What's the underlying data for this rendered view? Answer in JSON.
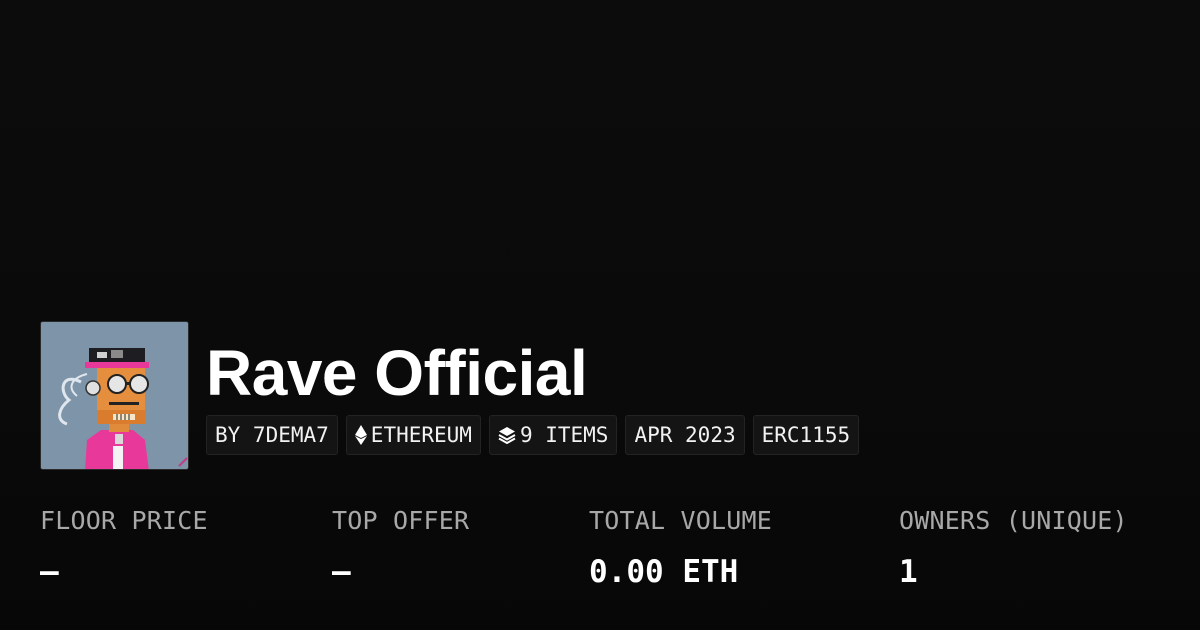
{
  "collection": {
    "name": "Rave Official",
    "avatar_icon": "pixel-ape-avatar"
  },
  "tags": [
    {
      "label": "BY 7DEMA7",
      "icon": ""
    },
    {
      "label": "ETHEREUM",
      "icon": "ethereum-icon"
    },
    {
      "label": "9 ITEMS",
      "icon": "layers-icon"
    },
    {
      "label": "APR 2023",
      "icon": ""
    },
    {
      "label": "ERC1155",
      "icon": ""
    }
  ],
  "stats": [
    {
      "label": "FLOOR PRICE",
      "value": "—"
    },
    {
      "label": "TOP OFFER",
      "value": "—"
    },
    {
      "label": "TOTAL VOLUME",
      "value": "0.00 ETH"
    },
    {
      "label": "OWNERS (UNIQUE)",
      "value": "1"
    }
  ],
  "colors": {
    "background": "#0b0b0b",
    "tag_background": "#141414",
    "label_gray": "#a8a8a8",
    "text": "#ffffff"
  }
}
